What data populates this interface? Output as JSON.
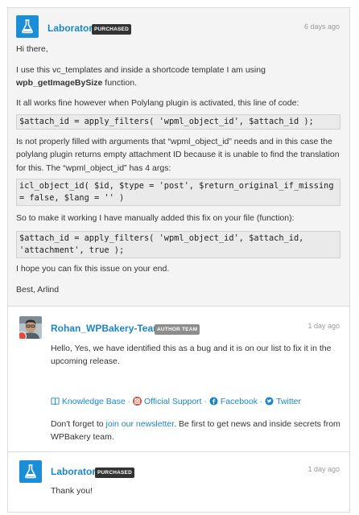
{
  "colors": {
    "accent": "#1b86c7",
    "purchased_badge": "#333333",
    "author_team_badge": "#8d8d8d"
  },
  "comments": [
    {
      "author": "Laborator",
      "badge": "PURCHASED",
      "time": "6 days ago",
      "avatar_icon": "flask-icon",
      "greeting": "Hi there,",
      "p1_pre": "I use this vc_templates and inside a shortcode template I am using ",
      "p1_bold": "wpb_getImageBySize",
      "p1_post": " function.",
      "p2": "It all works fine however when Polylang plugin is activated, this line of code:",
      "code1": "$attach_id = apply_filters( 'wpml_object_id', $attach_id );",
      "p3": "Is not properly filled with arguments that “wpml_object_id” needs and in this case the polylang plugin returns empty attachment ID because it is unable to find the translation for this. The “wpml_object_id” has 4 args:",
      "code2": "icl_object_id( $id, $type = 'post', $return_original_if_missing = false, $lang = '' )",
      "p4": "So to make it working I have manually added this fix on your file (function):",
      "code3": "$attach_id = apply_filters( 'wpml_object_id', $attach_id, 'attachment', true );",
      "p5": "I hope you can fix this issue on your end.",
      "p6": "Best, Arlind"
    },
    {
      "author": "Rohan_WPBakery-Team",
      "badge": "AUTHOR TEAM",
      "time": "1 day ago",
      "avatar_icon": "user-photo-avatar",
      "p1": "Hello, Yes, we have identified this as a bug and it is on our list to fix it in the upcoming release.",
      "links": [
        {
          "label": "Knowledge Base",
          "icon": "book-icon"
        },
        {
          "label": "Official Support",
          "icon": "lifebuoy-icon"
        },
        {
          "label": "Facebook",
          "icon": "facebook-icon"
        },
        {
          "label": "Twitter",
          "icon": "twitter-icon"
        }
      ],
      "separator": "·",
      "p2_pre": "Don't forget to ",
      "p2_link": "join our newsletter",
      "p2_post": ". Be first to get news and inside secrets from WPBakery team."
    },
    {
      "author": "Laborator",
      "badge": "PURCHASED",
      "time": "1 day ago",
      "avatar_icon": "flask-icon",
      "p1": "Thank you!"
    }
  ]
}
